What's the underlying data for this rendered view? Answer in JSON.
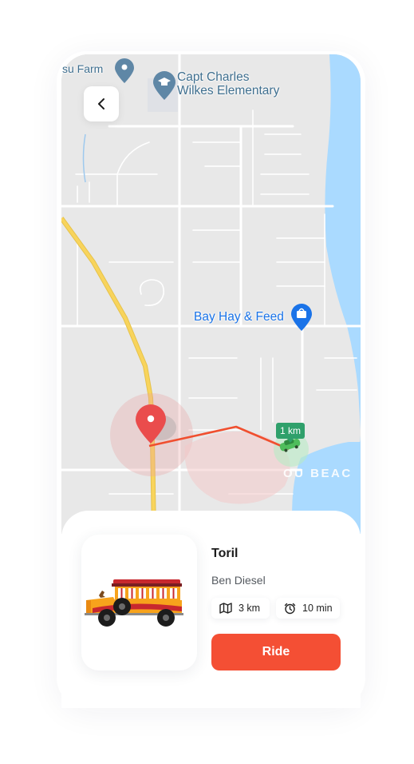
{
  "map": {
    "place_farm": "su Farm",
    "place_school_line1": "Capt Charles",
    "place_school_line2": "Wilkes Elementary",
    "place_store": "Bay Hay & Feed",
    "place_beach": "OU BEAC",
    "distance_tag": "1 km",
    "colors": {
      "water": "#aadaff",
      "highway": "#f8d45c",
      "route": "#f04f2f",
      "pin": "#ea4c4c",
      "store_pin": "#1a73e8"
    }
  },
  "icons": {
    "back": "chevron-left-icon",
    "distance": "map-icon",
    "time": "alarm-clock-icon",
    "vehicle": "jeepney-icon"
  },
  "ride": {
    "route_name": "Toril",
    "driver": "Ben Diesel",
    "distance": "3 km",
    "duration": "10 min",
    "action_label": "Ride",
    "accent_color": "#f44f34"
  }
}
